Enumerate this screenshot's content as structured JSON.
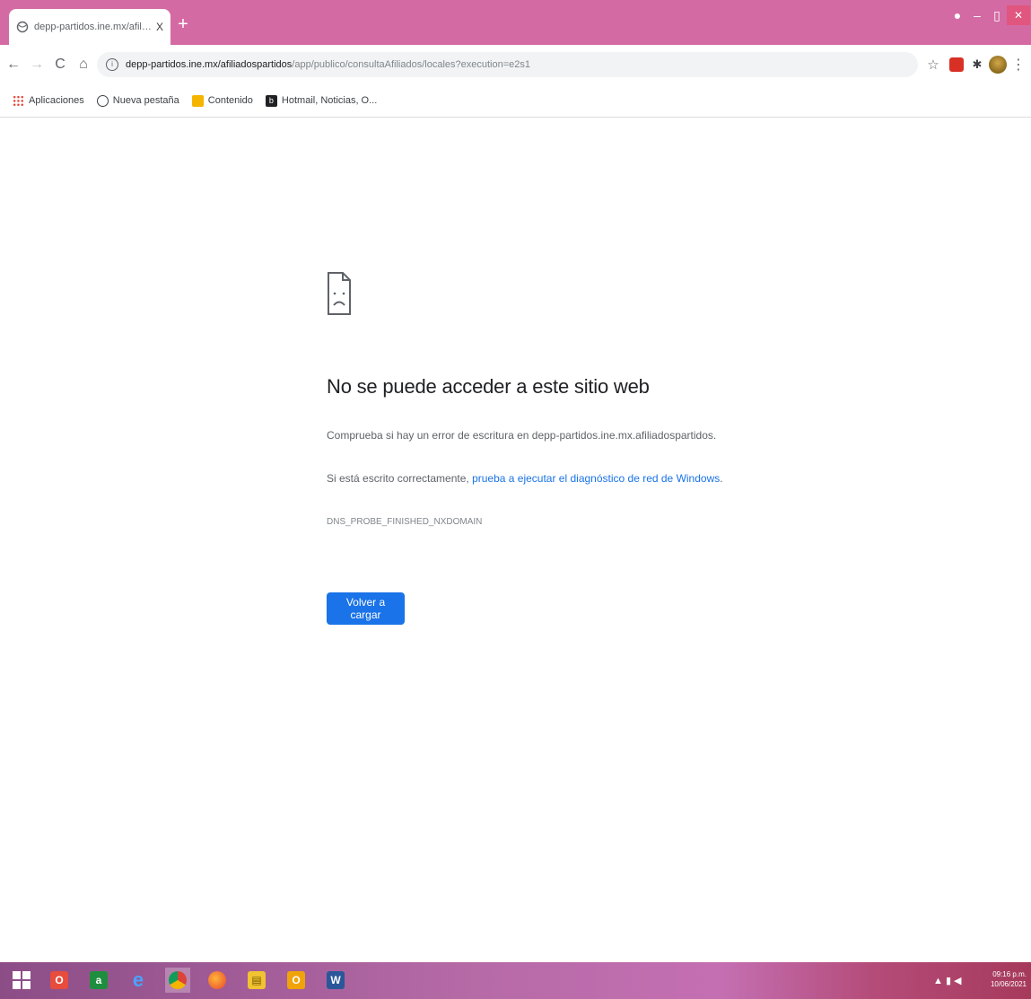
{
  "browser": {
    "tab": {
      "title": "depp-partidos.ine.mx/afiliados",
      "close_glyph": "X"
    },
    "new_tab_glyph": "+",
    "window_controls": {
      "profile": "●",
      "minimize": "–",
      "maximize": "▯",
      "close": "✕"
    },
    "nav": {
      "back": "←",
      "forward": "→",
      "reload": "C",
      "home": "⌂"
    },
    "address": {
      "host": "depp-partidos.ine.mx/afiliadospartidos",
      "path": "/app/publico/consultaAfiliados/locales?execution=e2s1"
    },
    "toolbar_icons": {
      "star": "☆",
      "ext_red": "",
      "puzzle": "✱",
      "menu": "⋮"
    }
  },
  "bookmarks": [
    {
      "label": "Aplicaciones",
      "icon": "apps-icon"
    },
    {
      "label": "Nueva pestaña",
      "icon": "globe-icon"
    },
    {
      "label": "Contenido",
      "icon": "folder-icon"
    },
    {
      "label": "Hotmail, Noticias, O...",
      "icon": "bing-icon"
    }
  ],
  "error_page": {
    "title": "No se puede acceder a este sitio web",
    "check_text": "Comprueba si hay un error de escritura en depp-partidos.ine.mx.afiliadospartidos.",
    "spelled_prefix": "Si está escrito correctamente, ",
    "diagnostic_link": "prueba a ejecutar el diagnóstico de red de Windows",
    "spelled_suffix": ".",
    "error_code": "DNS_PROBE_FINISHED_NXDOMAIN",
    "reload_button": "Volver a cargar"
  },
  "taskbar": {
    "apps": [
      {
        "name": "opera",
        "glyph": "O",
        "color": "#e74c3c"
      },
      {
        "name": "calc",
        "glyph": "a",
        "color": "#1e8e3e"
      },
      {
        "name": "ie",
        "glyph": "e",
        "color": "#2b7bd6"
      },
      {
        "name": "chrome",
        "glyph": "●",
        "color": "#db4437"
      },
      {
        "name": "firefox",
        "glyph": "●",
        "color": "#ff7a1a"
      },
      {
        "name": "files",
        "glyph": "▤",
        "color": "#f1c232"
      },
      {
        "name": "outlook",
        "glyph": "O",
        "color": "#f0a30a"
      },
      {
        "name": "word",
        "glyph": "W",
        "color": "#2b579a"
      }
    ],
    "tray": {
      "icons": "▲ ▮ ◀",
      "time": "09:16 p.m.",
      "date": "10/06/2021"
    }
  }
}
